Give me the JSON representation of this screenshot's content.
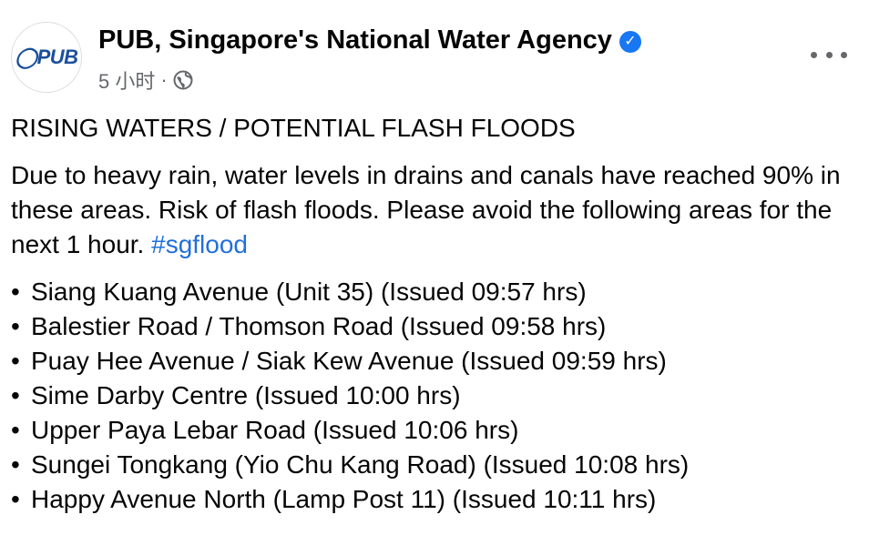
{
  "post": {
    "author": "PUB, Singapore's National Water Agency",
    "avatar_text": "PUB",
    "timestamp": "5 小时",
    "separator": "·",
    "audience_icon": "globe-icon",
    "more_icon": "more-options-icon",
    "heading": "RISING WATERS / POTENTIAL FLASH FLOODS",
    "message": "Due to heavy rain, water levels in drains and canals have reached 90% in these areas. Risk of flash floods. Please avoid the following areas for the next 1 hour.",
    "hashtag": "#sgflood",
    "bullet": "•",
    "areas": [
      "Siang Kuang Avenue (Unit 35) (Issued 09:57 hrs)",
      "Balestier Road / Thomson Road (Issued 09:58 hrs)",
      "Puay Hee Avenue / Siak Kew Avenue (Issued 09:59 hrs)",
      "Sime Darby Centre (Issued 10:00 hrs)",
      "Upper Paya Lebar Road (Issued 10:06 hrs)",
      "Sungei Tongkang (Yio Chu Kang Road) (Issued 10:08 hrs)",
      "Happy Avenue North (Lamp Post 11) (Issued 10:11 hrs)"
    ],
    "colors": {
      "verified": "#1877f2",
      "hashtag": "#216fdb",
      "muted": "#65676b",
      "logo": "#1a4f9c"
    }
  }
}
